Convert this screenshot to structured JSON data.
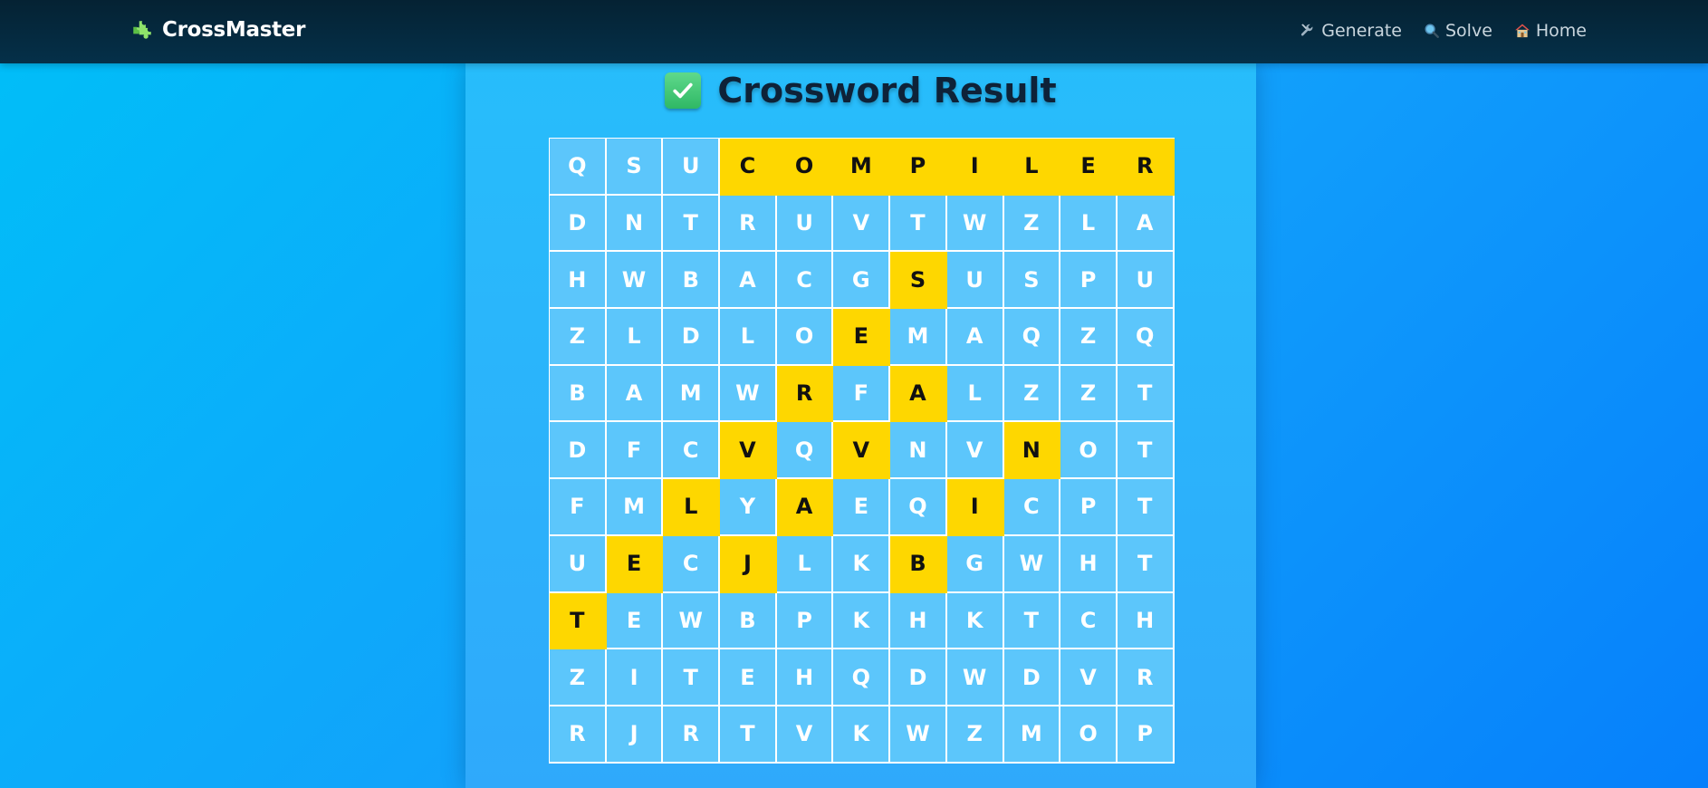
{
  "nav": {
    "brand": "CrossMaster",
    "brand_icon": "puzzle-piece-icon",
    "links": [
      {
        "label": "Generate",
        "icon": "tools-icon"
      },
      {
        "label": "Solve",
        "icon": "magnifier-icon"
      },
      {
        "label": "Home",
        "icon": "house-icon"
      }
    ]
  },
  "main": {
    "title": "Crossword Result",
    "title_icon": "check-mark-button-icon"
  },
  "colors": {
    "navbar": "#052233",
    "background": "#12a2fb",
    "panel": "#2ab5fb",
    "cell": "#5cc6fb",
    "highlight": "#fed700"
  },
  "grid": {
    "rows": [
      [
        "Q",
        "S",
        "U",
        "C",
        "O",
        "M",
        "P",
        "I",
        "L",
        "E",
        "R"
      ],
      [
        "D",
        "N",
        "T",
        "R",
        "U",
        "V",
        "T",
        "W",
        "Z",
        "L",
        "A"
      ],
      [
        "H",
        "W",
        "B",
        "A",
        "C",
        "G",
        "S",
        "U",
        "S",
        "P",
        "U"
      ],
      [
        "Z",
        "L",
        "D",
        "L",
        "O",
        "E",
        "M",
        "A",
        "Q",
        "Z",
        "Q"
      ],
      [
        "B",
        "A",
        "M",
        "W",
        "R",
        "F",
        "A",
        "L",
        "Z",
        "Z",
        "T"
      ],
      [
        "D",
        "F",
        "C",
        "V",
        "Q",
        "V",
        "N",
        "V",
        "N",
        "O",
        "T"
      ],
      [
        "F",
        "M",
        "L",
        "Y",
        "A",
        "E",
        "Q",
        "I",
        "C",
        "P",
        "T"
      ],
      [
        "U",
        "E",
        "C",
        "J",
        "L",
        "K",
        "B",
        "G",
        "W",
        "H",
        "T"
      ],
      [
        "T",
        "E",
        "W",
        "B",
        "P",
        "K",
        "H",
        "K",
        "T",
        "C",
        "H"
      ],
      [
        "Z",
        "I",
        "T",
        "E",
        "H",
        "Q",
        "D",
        "W",
        "D",
        "V",
        "R"
      ],
      [
        "R",
        "J",
        "R",
        "T",
        "V",
        "K",
        "W",
        "Z",
        "M",
        "O",
        "P"
      ]
    ],
    "highlighted": [
      [
        0,
        3
      ],
      [
        0,
        4
      ],
      [
        0,
        5
      ],
      [
        0,
        6
      ],
      [
        0,
        7
      ],
      [
        0,
        8
      ],
      [
        0,
        9
      ],
      [
        0,
        10
      ],
      [
        2,
        6
      ],
      [
        3,
        5
      ],
      [
        4,
        4
      ],
      [
        5,
        3
      ],
      [
        6,
        2
      ],
      [
        7,
        1
      ],
      [
        8,
        0
      ],
      [
        4,
        6
      ],
      [
        5,
        5
      ],
      [
        6,
        4
      ],
      [
        7,
        3
      ],
      [
        5,
        8
      ],
      [
        6,
        7
      ],
      [
        7,
        6
      ]
    ]
  }
}
